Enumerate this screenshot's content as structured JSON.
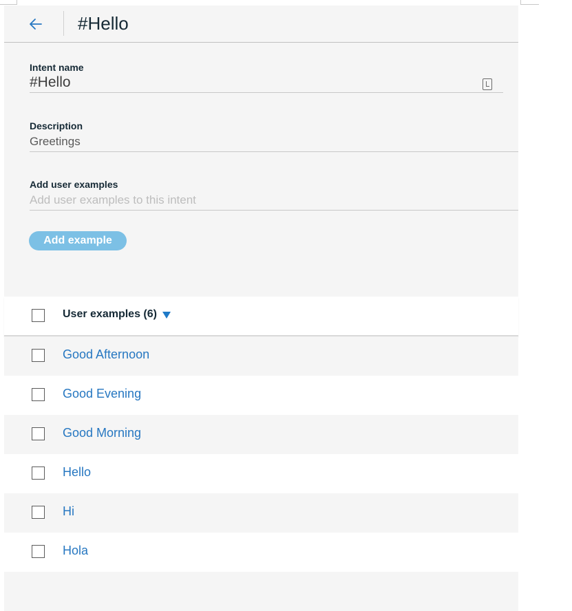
{
  "header": {
    "back_icon": "arrow-left-icon",
    "title": "#Hello"
  },
  "form": {
    "intent_name_label": "Intent name",
    "intent_name_value": "#Hello",
    "intent_name_icon": "clipboard-icon",
    "description_label": "Description",
    "description_value": "Greetings",
    "examples_label": "Add user examples",
    "examples_placeholder": "Add user examples to this intent",
    "add_button_label": "Add example"
  },
  "list": {
    "header_label": "User examples (6)",
    "sort_icon": "caret-down-icon",
    "items": [
      {
        "label": "Good Afternoon"
      },
      {
        "label": "Good Evening"
      },
      {
        "label": "Good Morning"
      },
      {
        "label": "Hello"
      },
      {
        "label": "Hi"
      },
      {
        "label": "Hola"
      }
    ]
  },
  "colors": {
    "accent": "#2677c1",
    "button": "#7cc0e5",
    "panel_bg": "#f5f5f5"
  }
}
